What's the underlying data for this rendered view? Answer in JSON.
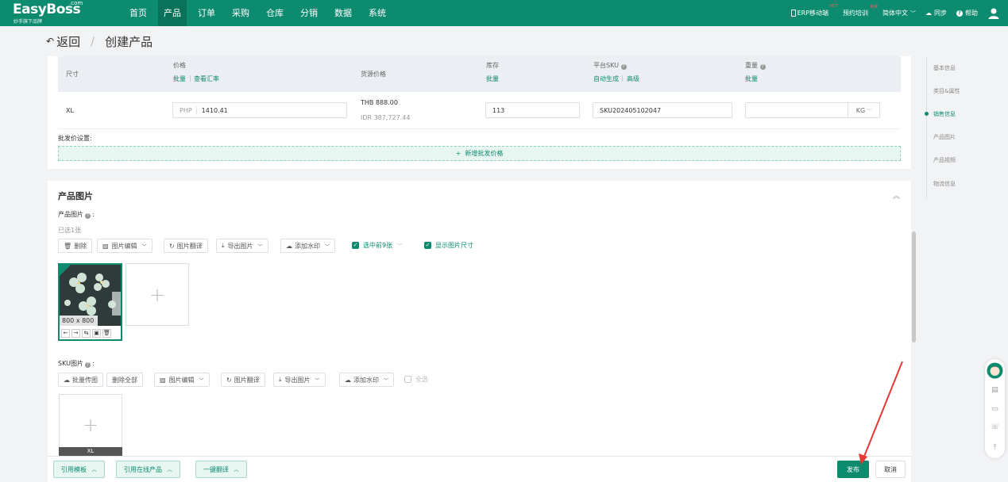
{
  "brand": {
    "name": "EasyBoss",
    "com": ".com",
    "tagline": "妙手旗下品牌"
  },
  "nav": [
    {
      "label": "首页"
    },
    {
      "label": "产品"
    },
    {
      "label": "订单"
    },
    {
      "label": "采购"
    },
    {
      "label": "仓库"
    },
    {
      "label": "分销"
    },
    {
      "label": "数据"
    },
    {
      "label": "系统"
    }
  ],
  "top_right": {
    "erp_mobile": "ERP移动端",
    "erp_badge": "HOT",
    "training": "预约培训",
    "training_badge": "免费",
    "language": "简体中文",
    "sync": "同步",
    "help": "帮助"
  },
  "breadcrumb": {
    "back": "返回",
    "separator": "/",
    "title": "创建产品"
  },
  "sku_table": {
    "headers": {
      "size": "尺寸",
      "price": "价格",
      "price_bulk": "批量",
      "price_rate": "查看汇率",
      "source_price": "货源价格",
      "stock": "库存",
      "stock_bulk": "批量",
      "platform_sku": "平台SKU",
      "sku_auto": "自动生成",
      "sku_advanced": "高级",
      "weight": "重量",
      "weight_bulk": "批量"
    },
    "row": {
      "size": "XL",
      "currency": "PHP",
      "price": "1410.41",
      "source_thb": "THB 888.00",
      "source_idr": "IDR 387,727.44",
      "stock": "113",
      "sku": "SKU202405102047",
      "weight": "",
      "weight_unit": "KG"
    }
  },
  "wholesale": {
    "label": "批发价设置:",
    "add": "新增批发价格"
  },
  "product_images": {
    "title": "产品图片",
    "label": "产品图片",
    "selected": "已选1张",
    "tools": [
      "删除",
      "图片编辑",
      "图片翻译",
      "导出图片",
      "添加水印"
    ],
    "select_first": "选中前9张",
    "show_size": "显示图片尺寸",
    "image_size": "800 x 800"
  },
  "sku_images": {
    "label": "SKU图片",
    "tools": [
      "批量传图",
      "删除全部",
      "图片编辑",
      "图片翻译",
      "导出图片",
      "添加水印"
    ],
    "select_all": "全选",
    "sku_tag": "XL"
  },
  "side_nav": [
    {
      "label": "基本信息"
    },
    {
      "label": "类目&属性"
    },
    {
      "label": "销售信息"
    },
    {
      "label": "产品图片"
    },
    {
      "label": "产品视频"
    },
    {
      "label": "物流信息"
    }
  ],
  "bottom_bar": {
    "use_template": "引用模板",
    "use_online": "引用在线产品",
    "translate": "一键翻译",
    "publish": "发布",
    "cancel": "取消"
  },
  "colors": {
    "primary": "#0c8b6f",
    "arrow": "#e53935"
  }
}
